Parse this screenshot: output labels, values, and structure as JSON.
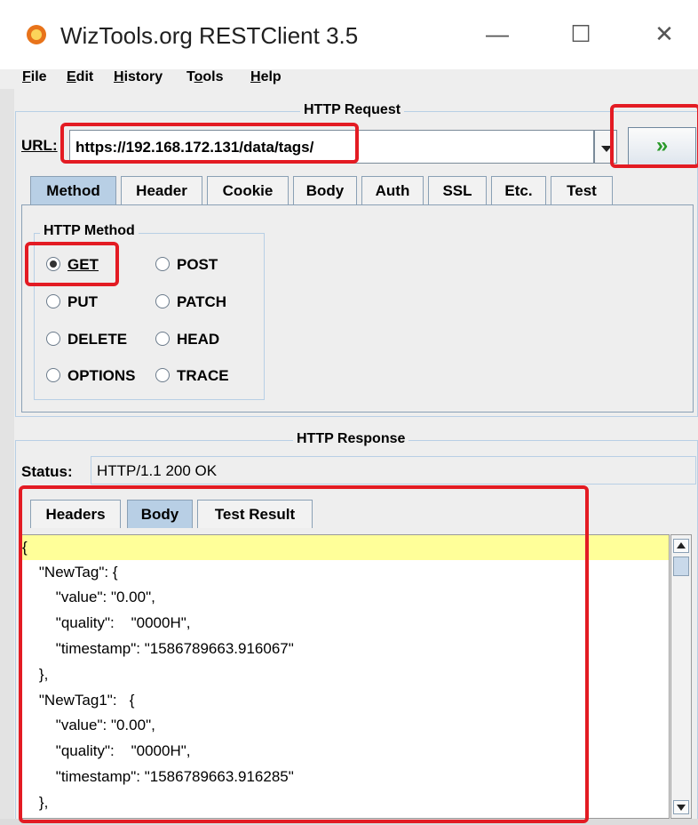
{
  "window": {
    "title": "WizTools.org RESTClient 3.5",
    "minimize_label": "—",
    "maximize_label": "☐",
    "close_label": "✕"
  },
  "menu": [
    {
      "label": "F",
      "rest": "ile"
    },
    {
      "label": "E",
      "rest": "dit"
    },
    {
      "label": "H",
      "rest": "istory"
    },
    {
      "pre": "T",
      "label": "o",
      "rest": "ols"
    },
    {
      "label": "H",
      "rest": "elp"
    }
  ],
  "request": {
    "section_title": "HTTP Request",
    "url_label": "URL:",
    "url_value": "https://192.168.172.131/data/tags/",
    "go_label": "»",
    "tabs": [
      "Method",
      "Header",
      "Cookie",
      "Body",
      "Auth",
      "SSL",
      "Etc.",
      "Test"
    ],
    "active_tab": "Method",
    "method_group_title": "HTTP Method",
    "methods": [
      "GET",
      "POST",
      "PUT",
      "PATCH",
      "DELETE",
      "HEAD",
      "OPTIONS",
      "TRACE"
    ],
    "selected_method": "GET"
  },
  "response": {
    "section_title": "HTTP Response",
    "status_label": "Status:",
    "status_value": "HTTP/1.1 200 OK",
    "tabs": [
      "Headers",
      "Body",
      "Test Result"
    ],
    "active_tab": "Body",
    "body_lines": [
      "{",
      "    \"NewTag\": {",
      "        \"value\": \"0.00\",",
      "        \"quality\":    \"0000H\",",
      "        \"timestamp\": \"1586789663.916067\"",
      "    },",
      "    \"NewTag1\":   {",
      "        \"value\": \"0.00\",",
      "        \"quality\":    \"0000H\",",
      "        \"timestamp\": \"1586789663.916285\"",
      "    },"
    ]
  },
  "colors": {
    "annotation_red": "#e31b23",
    "active_tab": "#b8cfe5",
    "highlight_line": "#ffff99",
    "go_arrow": "#2a9a2a"
  }
}
